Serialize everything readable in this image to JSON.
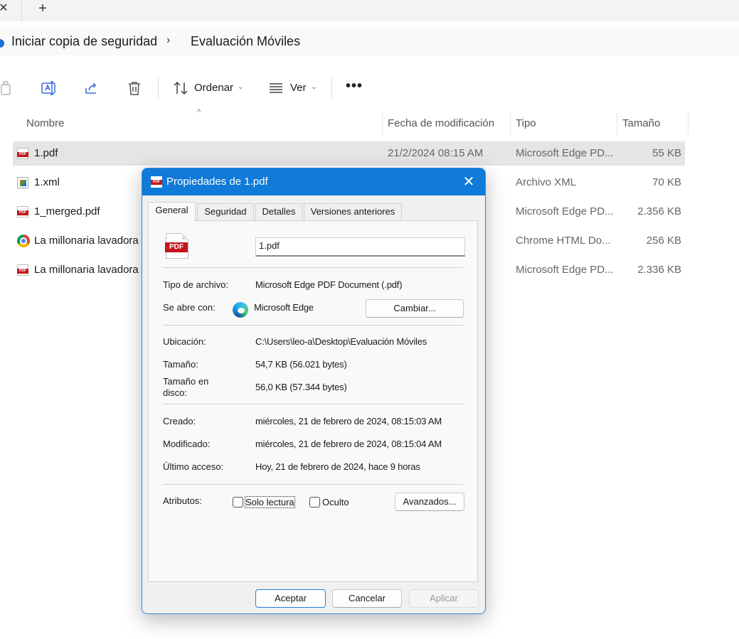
{
  "tabstrip": {
    "close_glyph": "✕",
    "new_tab_glyph": "+"
  },
  "breadcrumb": {
    "items": [
      "Iniciar copia de seguridad",
      "Evaluación Móviles"
    ],
    "separator": "›"
  },
  "command_bar": {
    "icons": [
      "copy-icon",
      "rename-icon",
      "share-icon",
      "delete-icon"
    ],
    "sort_label": "Ordenar",
    "view_label": "Ver",
    "more_glyph": "•••"
  },
  "columns": {
    "name": "Nombre",
    "modified": "Fecha de modificación",
    "type": "Tipo",
    "size": "Tamaño"
  },
  "files": [
    {
      "name": "1.pdf",
      "modified": "21/2/2024 08:15 AM",
      "type": "Microsoft Edge PD...",
      "size": "55 KB",
      "icon": "pdf-icon"
    },
    {
      "name": "1.xml",
      "modified": "",
      "type": "Archivo XML",
      "size": "70 KB",
      "icon": "xml-icon"
    },
    {
      "name": "1_merged.pdf",
      "modified": "",
      "type": "Microsoft Edge PD...",
      "size": "2.356 KB",
      "icon": "pdf-icon"
    },
    {
      "name": "La millonaria lavadora",
      "modified": "",
      "type": "Chrome HTML Do...",
      "size": "256 KB",
      "icon": "chrome-icon"
    },
    {
      "name": "La millonaria lavadora",
      "modified": "",
      "type": "Microsoft Edge PD...",
      "size": "2.336 KB",
      "icon": "pdf-icon"
    }
  ],
  "dialog": {
    "title": "Propiedades de 1.pdf",
    "close_glyph": "✕",
    "tabs": [
      "General",
      "Seguridad",
      "Detalles",
      "Versiones anteriores"
    ],
    "file_icon_text": "PDF",
    "file_name": "1.pdf",
    "labels": {
      "file_type": "Tipo de archivo:",
      "opens_with": "Se abre con:",
      "location": "Ubicación:",
      "size": "Tamaño:",
      "size_on_disk_1": "Tamaño en",
      "size_on_disk_2": "disco:",
      "created": "Creado:",
      "modified": "Modificado:",
      "accessed": "Último acceso:",
      "attributes": "Atributos:"
    },
    "values": {
      "file_type": "Microsoft Edge PDF Document (.pdf)",
      "opens_with": "Microsoft Edge",
      "location": "C:\\Users\\leo-a\\Desktop\\Evaluación Móviles",
      "size": "54,7 KB (56.021 bytes)",
      "size_on_disk": "56,0 KB (57.344 bytes)",
      "created": "miércoles, 21 de febrero de 2024, 08:15:03 AM",
      "modified": "miércoles, 21 de febrero de 2024, 08:15:04 AM",
      "accessed": "Hoy, 21 de febrero de 2024, hace 9 horas"
    },
    "change_button": "Cambiar...",
    "readonly_label": "Solo lectura",
    "hidden_label": "Oculto",
    "readonly_checked": false,
    "hidden_checked": false,
    "advanced_button": "Avanzados...",
    "ok_button": "Aceptar",
    "cancel_button": "Cancelar",
    "apply_button": "Aplicar"
  },
  "colors": {
    "accent": "#0f7ad8",
    "pdf_red": "#c4161c",
    "selected_row": "#e5e5e5"
  }
}
